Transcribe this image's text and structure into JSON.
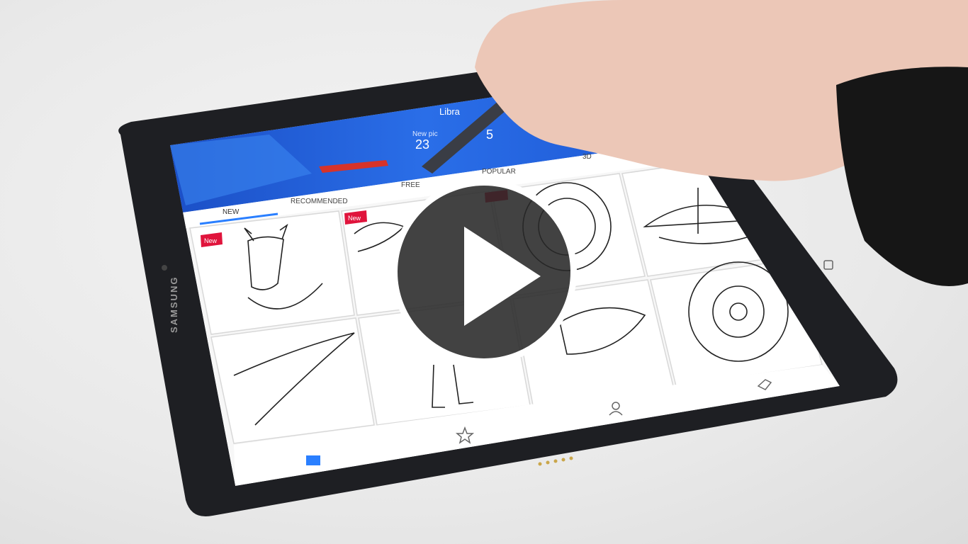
{
  "device": {
    "brand": "SAMSUNG"
  },
  "app": {
    "header_title": "Libra",
    "header_subtitle": "New pic",
    "header_count": "23",
    "header_count_tail": "5",
    "tabs": [
      {
        "label": "NEW",
        "active": true
      },
      {
        "label": "RECOMMENDED",
        "active": false
      },
      {
        "label": "FREE",
        "active": false
      },
      {
        "label": "POPULAR",
        "active": false
      },
      {
        "label": "3D",
        "active": false
      }
    ],
    "badge_label": "New",
    "thumbnails": [
      {
        "subject": "fox-with-glasses",
        "badge": true
      },
      {
        "subject": "angel-wings",
        "badge": true
      },
      {
        "subject": "mandala-circle",
        "badge": true
      },
      {
        "subject": "umbrella"
      },
      {
        "subject": "pterodactyl"
      },
      {
        "subject": "girl-in-boots"
      },
      {
        "subject": "dog-with-hat"
      },
      {
        "subject": "mandala-flower"
      }
    ],
    "bottom_nav": [
      {
        "icon": "book-icon",
        "active": true
      },
      {
        "icon": "star-icon",
        "active": false
      },
      {
        "icon": "person-icon",
        "active": false
      },
      {
        "icon": "tag-icon",
        "active": false
      }
    ]
  },
  "colors": {
    "header_blue": "#1f5fd6",
    "accent_blue": "#2a7fff",
    "badge_red": "#e0143c",
    "bezel": "#1e1f23"
  },
  "video": {
    "control": "play-button"
  }
}
